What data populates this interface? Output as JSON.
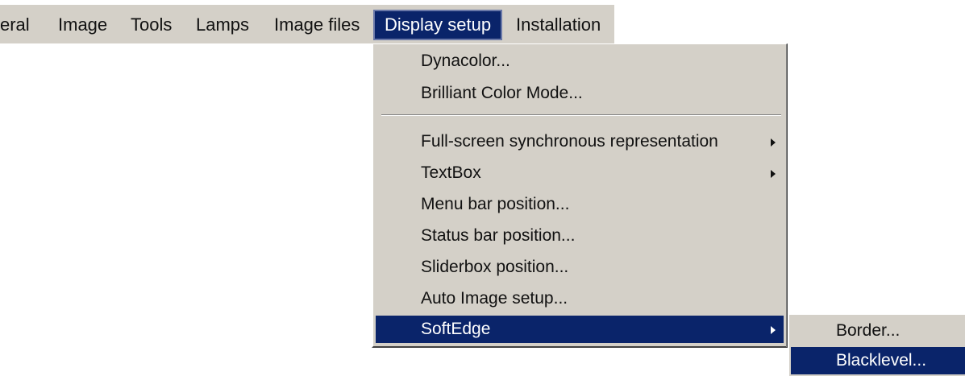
{
  "menubar": {
    "items": [
      {
        "label": "eral"
      },
      {
        "label": "Image"
      },
      {
        "label": "Tools"
      },
      {
        "label": "Lamps"
      },
      {
        "label": "Image files"
      },
      {
        "label": "Display setup",
        "active": true
      },
      {
        "label": "Installation"
      }
    ]
  },
  "dropdown": {
    "items": [
      {
        "label": "Dynacolor..."
      },
      {
        "label": "Brilliant Color Mode..."
      },
      {
        "label": "Full-screen synchronous representation",
        "has_submenu": true
      },
      {
        "label": "TextBox",
        "has_submenu": true
      },
      {
        "label": "Menu bar position..."
      },
      {
        "label": "Status bar position..."
      },
      {
        "label": "Sliderbox position..."
      },
      {
        "label": "Auto Image setup..."
      },
      {
        "label": "SoftEdge",
        "has_submenu": true,
        "highlighted": true
      }
    ]
  },
  "submenu": {
    "items": [
      {
        "label": "Border..."
      },
      {
        "label": "Blacklevel...",
        "highlighted": true
      }
    ]
  },
  "colors": {
    "menu_background": "#d4d0c8",
    "highlight": "#0a246a",
    "highlight_text": "#ffffff"
  }
}
